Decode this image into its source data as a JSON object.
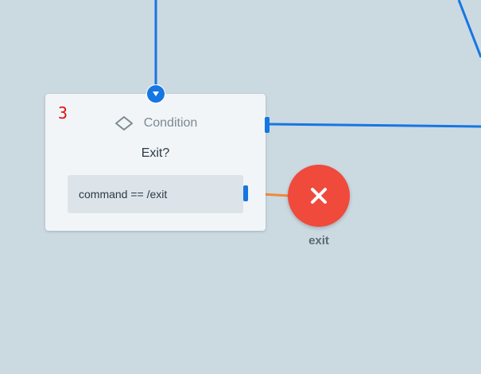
{
  "node": {
    "step_number": "3",
    "type_icon": "diamond-icon",
    "type_label": "Condition",
    "title": "Exit?",
    "condition": "command == /exit"
  },
  "exit_node": {
    "icon": "close-icon",
    "label": "exit"
  },
  "colors": {
    "canvas_background": "#cbd9e1",
    "connector": "#1676e2",
    "exit_connector": "#f0883a",
    "exit_node": "#ef4a3c",
    "step_number": "#e01010"
  }
}
